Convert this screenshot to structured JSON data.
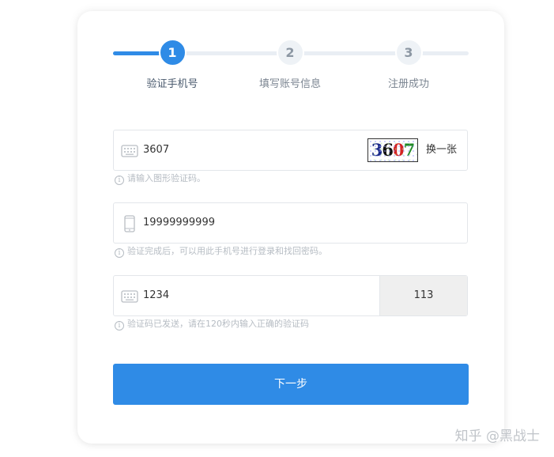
{
  "steps": [
    {
      "number": "1",
      "label": "验证手机号"
    },
    {
      "number": "2",
      "label": "填写账号信息"
    },
    {
      "number": "3",
      "label": "注册成功"
    }
  ],
  "captcha_field": {
    "value": "3607",
    "captcha_chars": [
      "3",
      "6",
      "0",
      "7"
    ],
    "refresh_label": "换一张",
    "hint": "请输入图形验证码。"
  },
  "phone_field": {
    "value": "19999999999",
    "hint": "验证完成后，可以用此手机号进行登录和找回密码。"
  },
  "sms_field": {
    "value": "1234",
    "countdown": "113",
    "hint": "验证码已发送，请在120秒内输入正确的验证码"
  },
  "next_button": "下一步",
  "watermark": "知乎 @黑战士",
  "info_glyph": "i",
  "colors": {
    "accent": "#2f8be6",
    "step_inactive": "#eef2f6",
    "hint": "#b6bcc3",
    "field_border": "#e3e6ea"
  },
  "icons": [
    "keyboard-icon",
    "phone-icon",
    "info-icon"
  ]
}
